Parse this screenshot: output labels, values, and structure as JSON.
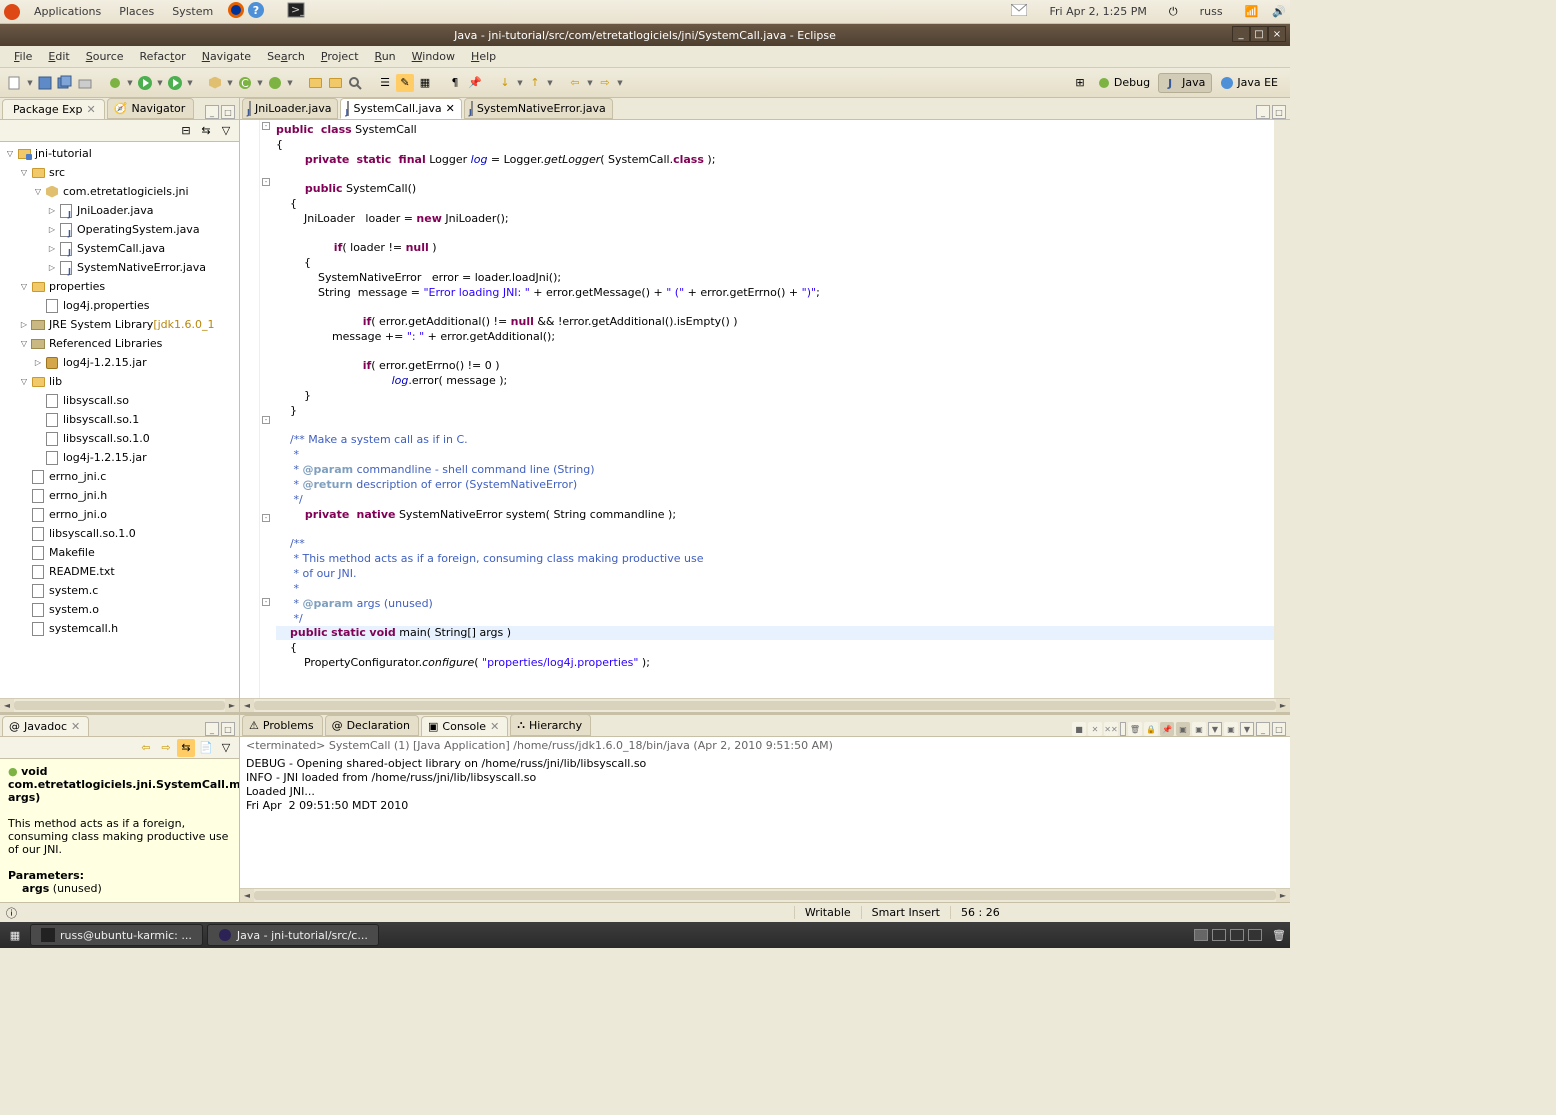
{
  "gnome": {
    "apps": "Applications",
    "places": "Places",
    "system": "System",
    "date": "Fri Apr 2,  1:25 PM",
    "user": "russ"
  },
  "window": {
    "title": "Java - jni-tutorial/src/com/etretatlogiciels/jni/SystemCall.java - Eclipse"
  },
  "menu": {
    "items": [
      "File",
      "Edit",
      "Source",
      "Refactor",
      "Navigate",
      "Search",
      "Project",
      "Run",
      "Window",
      "Help"
    ]
  },
  "perspectives": {
    "debug": "Debug",
    "java": "Java",
    "javaee": "Java EE"
  },
  "left_views": {
    "tab1": "Package Exp",
    "tab2": "Navigator"
  },
  "tree": [
    {
      "d": 0,
      "t": "down",
      "ic": "project",
      "label": "jni-tutorial"
    },
    {
      "d": 1,
      "t": "down",
      "ic": "folder",
      "label": "src"
    },
    {
      "d": 2,
      "t": "down",
      "ic": "package",
      "label": "com.etretatlogiciels.jni"
    },
    {
      "d": 3,
      "t": "right",
      "ic": "java",
      "label": "JniLoader.java"
    },
    {
      "d": 3,
      "t": "right",
      "ic": "java",
      "label": "OperatingSystem.java"
    },
    {
      "d": 3,
      "t": "right",
      "ic": "java",
      "label": "SystemCall.java"
    },
    {
      "d": 3,
      "t": "right",
      "ic": "java",
      "label": "SystemNativeError.java"
    },
    {
      "d": 1,
      "t": "down",
      "ic": "folder",
      "label": "properties"
    },
    {
      "d": 2,
      "t": "",
      "ic": "file",
      "label": "log4j.properties"
    },
    {
      "d": 1,
      "t": "right",
      "ic": "lib",
      "label": "JRE System Library",
      "suffix": "[jdk1.6.0_1"
    },
    {
      "d": 1,
      "t": "down",
      "ic": "lib",
      "label": "Referenced Libraries"
    },
    {
      "d": 2,
      "t": "right",
      "ic": "jar",
      "label": "log4j-1.2.15.jar"
    },
    {
      "d": 1,
      "t": "down",
      "ic": "folder",
      "label": "lib"
    },
    {
      "d": 2,
      "t": "",
      "ic": "file",
      "label": "libsyscall.so"
    },
    {
      "d": 2,
      "t": "",
      "ic": "file",
      "label": "libsyscall.so.1"
    },
    {
      "d": 2,
      "t": "",
      "ic": "file",
      "label": "libsyscall.so.1.0"
    },
    {
      "d": 2,
      "t": "",
      "ic": "file",
      "label": "log4j-1.2.15.jar"
    },
    {
      "d": 1,
      "t": "",
      "ic": "file",
      "label": "errno_jni.c"
    },
    {
      "d": 1,
      "t": "",
      "ic": "file",
      "label": "errno_jni.h"
    },
    {
      "d": 1,
      "t": "",
      "ic": "file",
      "label": "errno_jni.o"
    },
    {
      "d": 1,
      "t": "",
      "ic": "file",
      "label": "libsyscall.so.1.0"
    },
    {
      "d": 1,
      "t": "",
      "ic": "file",
      "label": "Makefile"
    },
    {
      "d": 1,
      "t": "",
      "ic": "file",
      "label": "README.txt"
    },
    {
      "d": 1,
      "t": "",
      "ic": "file",
      "label": "system.c"
    },
    {
      "d": 1,
      "t": "",
      "ic": "file",
      "label": "system.o"
    },
    {
      "d": 1,
      "t": "",
      "ic": "file",
      "label": "systemcall.h"
    }
  ],
  "editor_tabs": {
    "tab1": "JniLoader.java",
    "tab2": "SystemCall.java",
    "tab3": "SystemNativeError.java"
  },
  "code": {
    "l1a": "public",
    "l1b": "class",
    "l1c": " SystemCall",
    "l2": "{",
    "l3a": "private",
    "l3b": "static",
    "l3c": "final",
    "l3d": " Logger ",
    "l3e": "log",
    "l3f": " = Logger.",
    "l3g": "getLogger",
    "l3h": "( SystemCall.",
    "l3i": "class",
    "l3j": " );",
    "l5a": "public",
    "l5b": " SystemCall()",
    "l6": "    {",
    "l7a": "        JniLoader   loader = ",
    "l7b": "new",
    "l7c": " JniLoader();",
    "l9a": "if",
    "l9b": "( loader != ",
    "l9c": "null",
    "l9d": " )",
    "l10": "        {",
    "l11": "            SystemNativeError   error = loader.loadJni();",
    "l12a": "            String  message = ",
    "l12b": "\"Error loading JNI: \"",
    "l12c": " + error.getMessage() + ",
    "l12d": "\" (\"",
    "l12e": " + error.getErrno() + ",
    "l12f": "\")\"",
    "l12g": ";",
    "l14a": "if",
    "l14b": "( error.getAdditional() != ",
    "l14c": "null",
    "l14d": " && !error.getAdditional().isEmpty() )",
    "l15a": "                message += ",
    "l15b": "\": \"",
    "l15c": " + error.getAdditional();",
    "l17a": "if",
    "l17b": "( error.getErrno() != 0 )",
    "l18a": "log",
    "l18b": ".error( message );",
    "l19": "        }",
    "l20": "    }",
    "l22": "    /** Make a system call as if in C.",
    "l23": "     *",
    "l24a": "     * ",
    "l24b": "@param",
    "l24c": " commandline - shell command line (String)",
    "l25a": "     * ",
    "l25b": "@return",
    "l25c": " description of error (SystemNativeError)",
    "l26": "     */",
    "l27a": "private",
    "l27b": "native",
    "l27c": " SystemNativeError system( String commandline );",
    "l29": "    /**",
    "l30": "     * This method acts as if a foreign, consuming class making productive use",
    "l31": "     * of our JNI.",
    "l32": "     *",
    "l33a": "     * ",
    "l33b": "@param",
    "l33c": " args (unused)",
    "l34": "     */",
    "l35a": "public",
    "l35b": "static",
    "l35c": "void",
    "l35d": " main( String[] args )",
    "l36": "    {",
    "l37a": "        PropertyConfigurator.",
    "l37b": "configure",
    "l37c": "( ",
    "l37d": "\"properties/log4j.properties\"",
    "l37e": " );"
  },
  "bottom_tabs": {
    "javadoc": "Javadoc",
    "problems": "Problems",
    "declaration": "Declaration",
    "console": "Console",
    "hierarchy": "Hierarchy"
  },
  "javadoc": {
    "sig1": "void",
    "sig2": "com.etretatlogiciels.jni.SystemCall.main(String[] args)",
    "desc": "This method acts as if a foreign, consuming class making productive use of our JNI.",
    "params_label": "Parameters:",
    "param1": "args",
    "param1_desc": " (unused)"
  },
  "console": {
    "title": "<terminated> SystemCall (1) [Java Application] /home/russ/jdk1.6.0_18/bin/java (Apr 2, 2010 9:51:50 AM)",
    "line1": "DEBUG - Opening shared-object library on /home/russ/jni/lib/libsyscall.so",
    "line2": "INFO - JNI loaded from /home/russ/jni/lib/libsyscall.so",
    "line3": "Loaded JNI...",
    "line4": "Fri Apr  2 09:51:50 MDT 2010"
  },
  "status": {
    "writable": "Writable",
    "insert": "Smart Insert",
    "pos": "56 : 26"
  },
  "taskbar": {
    "t1": "russ@ubuntu-karmic: ...",
    "t2": "Java - jni-tutorial/src/c..."
  }
}
